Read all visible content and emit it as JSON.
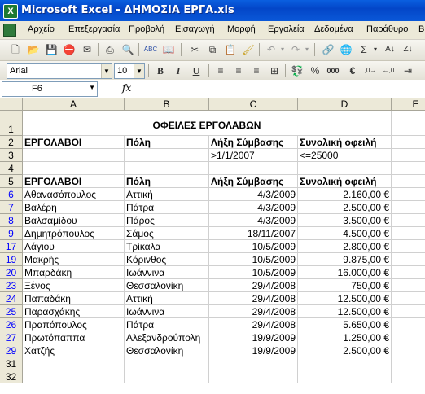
{
  "window": {
    "title": "Microsoft Excel - ΔΗΜΟΣΙΑ ΕΡΓΑ.xls",
    "app_icon": "excel-icon"
  },
  "menu": [
    "Αρχείο",
    "Επεξεργασία",
    "Προβολή",
    "Εισαγωγή",
    "Μορφή",
    "Εργαλεία",
    "Δεδομένα",
    "Παράθυρο",
    "Β"
  ],
  "format_toolbar": {
    "font": "Arial",
    "size": "10",
    "bold": "B",
    "italic": "I",
    "underline": "U",
    "percent": "%",
    "thousands": "000",
    "currency": "€"
  },
  "formula_bar": {
    "name_box": "F6",
    "fx": "fx",
    "content": ""
  },
  "columns": [
    "A",
    "B",
    "C",
    "D",
    "E"
  ],
  "rows": [
    {
      "num": "1",
      "cells": [
        "",
        "ΟΦΕΙΛΕΣ ΕΡΓΟΛΑΒΩΝ",
        "",
        "",
        ""
      ]
    },
    {
      "num": "2",
      "cells": [
        "ΕΡΓΟΛΑΒΟΙ",
        "Πόλη",
        "Λήξη Σύμβασης",
        "Συνολική οφειλή",
        ""
      ]
    },
    {
      "num": "3",
      "cells": [
        "",
        "",
        ">1/1/2007",
        "<=25000",
        ""
      ]
    },
    {
      "num": "4",
      "cells": [
        "",
        "",
        "",
        "",
        ""
      ]
    },
    {
      "num": "5",
      "cells": [
        "ΕΡΓΟΛΑΒΟΙ",
        "Πόλη",
        "Λήξη Σύμβασης",
        "Συνολική οφειλή",
        ""
      ]
    },
    {
      "num": "6",
      "cells": [
        "Αθανασόπουλος",
        "Αττική",
        "4/3/2009",
        "2.160,00 €",
        ""
      ]
    },
    {
      "num": "7",
      "cells": [
        "Βαλέρη",
        "Πάτρα",
        "4/3/2009",
        "2.500,00 €",
        ""
      ]
    },
    {
      "num": "8",
      "cells": [
        "Βαλσαμίδου",
        "Πάρος",
        "4/3/2009",
        "3.500,00 €",
        ""
      ]
    },
    {
      "num": "9",
      "cells": [
        "Δημητρόπουλος",
        "Σάμος",
        "18/11/2007",
        "4.500,00 €",
        ""
      ]
    },
    {
      "num": "17",
      "cells": [
        "Λάγιου",
        "Τρίκαλα",
        "10/5/2009",
        "2.800,00 €",
        ""
      ]
    },
    {
      "num": "19",
      "cells": [
        "Μακρής",
        "Κόρινθος",
        "10/5/2009",
        "9.875,00 €",
        ""
      ]
    },
    {
      "num": "20",
      "cells": [
        "Μπαρδάκη",
        "Ιωάννινα",
        "10/5/2009",
        "16.000,00 €",
        ""
      ]
    },
    {
      "num": "23",
      "cells": [
        "Ξένος",
        "Θεσσαλονίκη",
        "29/4/2008",
        "750,00 €",
        ""
      ]
    },
    {
      "num": "24",
      "cells": [
        "Παπαδάκη",
        "Αττική",
        "29/4/2008",
        "12.500,00 €",
        ""
      ]
    },
    {
      "num": "25",
      "cells": [
        "Παρασχάκης",
        "Ιωάννινα",
        "29/4/2008",
        "12.500,00 €",
        ""
      ]
    },
    {
      "num": "26",
      "cells": [
        "Πραπόπουλος",
        "Πάτρα",
        "29/4/2008",
        "5.650,00 €",
        ""
      ]
    },
    {
      "num": "27",
      "cells": [
        "Πρωτόπαππα",
        "Αλεξανδρούπολη",
        "19/9/2009",
        "1.250,00 €",
        ""
      ]
    },
    {
      "num": "29",
      "cells": [
        "Χατζής",
        "Θεσσαλονίκη",
        "19/9/2009",
        "2.500,00 €",
        ""
      ]
    },
    {
      "num": "31",
      "cells": [
        "",
        "",
        "",
        "",
        ""
      ]
    },
    {
      "num": "32",
      "cells": [
        "",
        "",
        "",
        "",
        ""
      ]
    }
  ],
  "colors": {
    "title_bar": "#0346c8",
    "filtered_row_number": "#0000ff",
    "header_bg": "#ece9d8"
  }
}
